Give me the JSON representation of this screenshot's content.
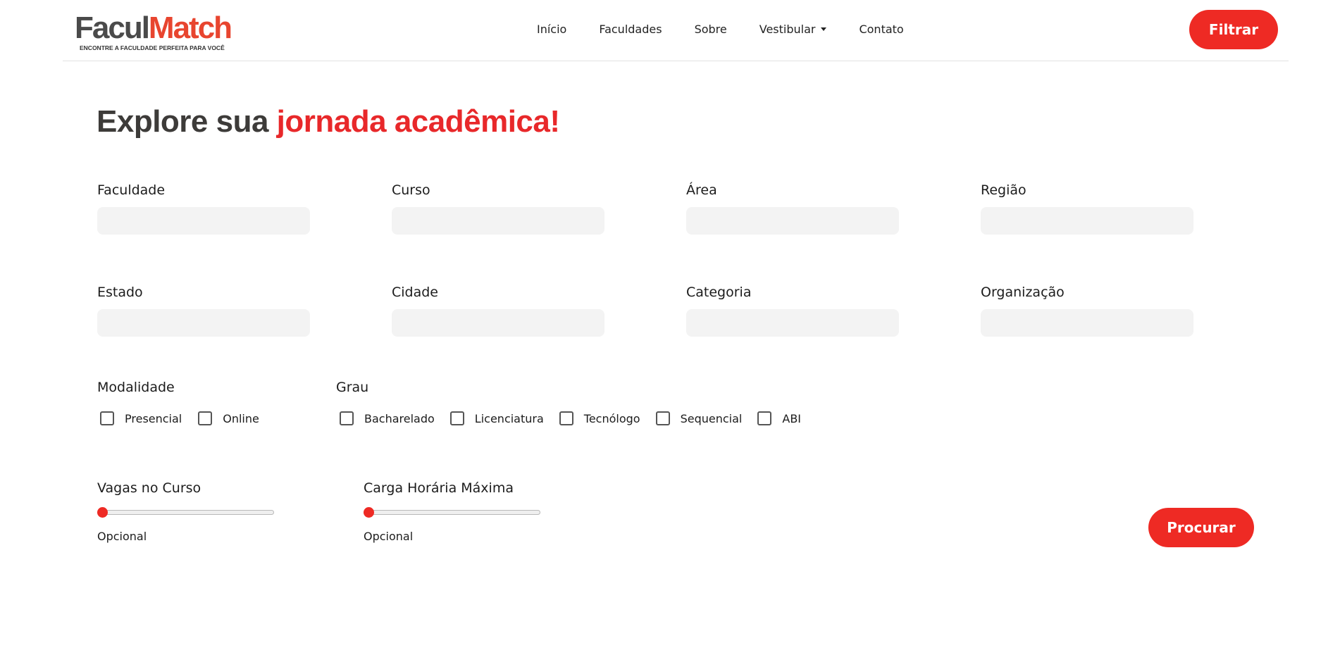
{
  "brand": {
    "name_part1": "Facul",
    "name_part2": "Match",
    "tagline": "ENCONTRE A FACULDADE PERFEITA PARA VOCÊ"
  },
  "nav": {
    "items": [
      "Início",
      "Faculdades",
      "Sobre",
      "Vestibular",
      "Contato"
    ],
    "filter_label": "Filtrar"
  },
  "headline": {
    "part1": "Explore sua",
    "part2": "jornada acadêmica!"
  },
  "filters": {
    "row1": [
      {
        "label": "Faculdade",
        "value": ""
      },
      {
        "label": "Curso",
        "value": ""
      },
      {
        "label": "Área",
        "value": ""
      },
      {
        "label": "Região",
        "value": ""
      }
    ],
    "row2": [
      {
        "label": "Estado",
        "value": ""
      },
      {
        "label": "Cidade",
        "value": ""
      },
      {
        "label": "Categoria",
        "value": ""
      },
      {
        "label": "Organização",
        "value": ""
      }
    ]
  },
  "modalidade": {
    "label": "Modalidade",
    "options": [
      {
        "label": "Presencial",
        "checked": false
      },
      {
        "label": "Online",
        "checked": false
      }
    ]
  },
  "grau": {
    "label": "Grau",
    "options": [
      {
        "label": "Bacharelado",
        "checked": false
      },
      {
        "label": "Licenciatura",
        "checked": false
      },
      {
        "label": "Tecnólogo",
        "checked": false
      },
      {
        "label": "Sequencial",
        "checked": false
      },
      {
        "label": "ABI",
        "checked": false
      }
    ]
  },
  "sliders": {
    "vagas": {
      "label": "Vagas no Curso",
      "hint": "Opcional",
      "level": 0
    },
    "carga": {
      "label": "Carga Horária Máxima",
      "hint": "Opcional",
      "level": 0
    }
  },
  "search_label": "Procurar",
  "colors": {
    "accent": "#ee2a24",
    "heading_dark": "#3d3b39",
    "input_bg": "#f3f3f3"
  }
}
